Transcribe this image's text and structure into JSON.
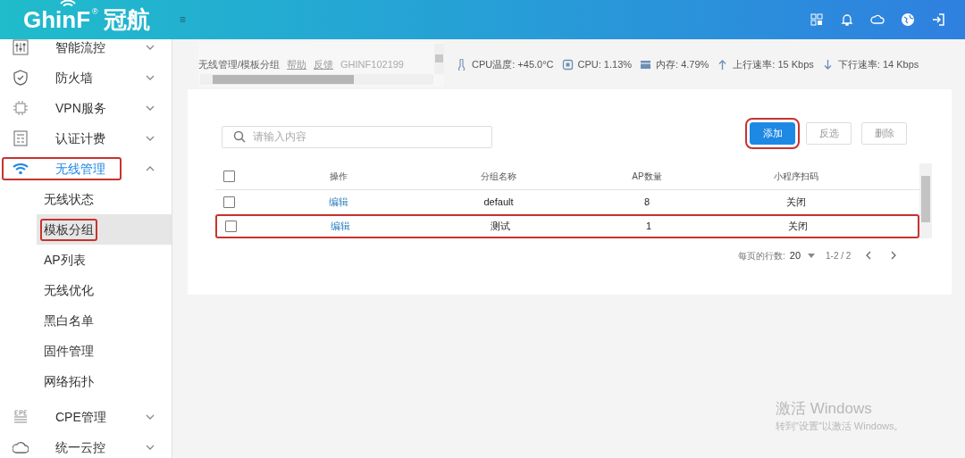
{
  "header": {
    "logo_text": "GhinF",
    "logo_mark": "®",
    "logo_cn": "冠航",
    "menu_glyph": "≡"
  },
  "sidebar": {
    "items": [
      {
        "label": "智能流控",
        "kind": "flow",
        "expanded": false,
        "selected": false,
        "highlighted": false
      },
      {
        "label": "防火墙",
        "kind": "shield",
        "expanded": false,
        "selected": false,
        "highlighted": false
      },
      {
        "label": "VPN服务",
        "kind": "vpn",
        "expanded": false,
        "selected": false,
        "highlighted": false
      },
      {
        "label": "认证计费",
        "kind": "doc",
        "expanded": false,
        "selected": false,
        "highlighted": false
      },
      {
        "label": "无线管理",
        "kind": "wifi",
        "expanded": true,
        "selected": true,
        "highlighted": true,
        "children": [
          {
            "label": "无线状态",
            "selected": false,
            "highlighted": false
          },
          {
            "label": "模板分组",
            "selected": true,
            "highlighted": true
          },
          {
            "label": "AP列表",
            "selected": false,
            "highlighted": false
          },
          {
            "label": "无线优化",
            "selected": false,
            "highlighted": false
          },
          {
            "label": "黑白名单",
            "selected": false,
            "highlighted": false
          },
          {
            "label": "固件管理",
            "selected": false,
            "highlighted": false
          },
          {
            "label": "网络拓扑",
            "selected": false,
            "highlighted": false
          }
        ]
      },
      {
        "label": "CPE管理",
        "kind": "cpe",
        "expanded": false,
        "selected": false,
        "highlighted": false
      },
      {
        "label": "统一云控",
        "kind": "cloud",
        "expanded": false,
        "selected": false,
        "highlighted": false
      }
    ]
  },
  "breadcrumb": {
    "path": "无线管理/模板分组",
    "links": [
      "帮助",
      "反馈"
    ],
    "device": "GHINF102199"
  },
  "stats": [
    {
      "kind": "temp",
      "text": "CPU温度: +45.0°C"
    },
    {
      "kind": "cpu",
      "text": "CPU: 1.13%"
    },
    {
      "kind": "mem",
      "text": "内存: 4.79%"
    },
    {
      "kind": "up",
      "text": "上行速率: 15 Kbps"
    },
    {
      "kind": "down",
      "text": "下行速率: 14 Kbps"
    }
  ],
  "search": {
    "placeholder": "请输入内容"
  },
  "buttons": [
    {
      "label": "添加",
      "kind": "primary",
      "highlighted": true
    },
    {
      "label": "反选",
      "kind": "plain",
      "highlighted": false
    },
    {
      "label": "删除",
      "kind": "plain",
      "highlighted": false
    }
  ],
  "table": {
    "columns": [
      "操作",
      "分组名称",
      "AP数量",
      "小程序扫码"
    ],
    "header_checked": false,
    "rows": [
      {
        "checked": false,
        "highlighted": false,
        "cells": [
          "编辑",
          "default",
          "8",
          "关闭"
        ]
      },
      {
        "checked": false,
        "highlighted": true,
        "cells": [
          "编辑",
          "测试",
          "1",
          "关闭"
        ]
      }
    ]
  },
  "pagination": {
    "label": "每页的行数:",
    "per_page": "20",
    "range": "1-2 / 2"
  },
  "os_notice": {
    "title": "激活 Windows",
    "text": "转到\"设置\"以激活 Windows。"
  }
}
